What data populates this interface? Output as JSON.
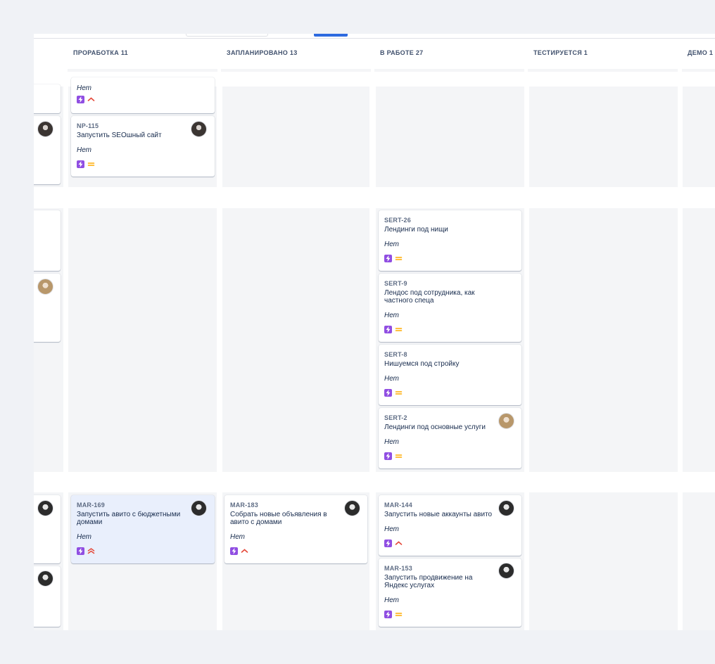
{
  "columns": [
    {
      "title": "ПРОРАБОТКА 11"
    },
    {
      "title": "ЗАПЛАНИРОВАНО 13"
    },
    {
      "title": "В РАБОТЕ 27"
    },
    {
      "title": "ТЕСТИРУЕТСЯ 1"
    },
    {
      "title": "ДЕМО 1"
    }
  ],
  "colors": {
    "epic": "#904ee2",
    "priority_high": "#e5493a",
    "priority_medium": "#ffab00",
    "selected_card": "#e9effc",
    "accent": "#2d6ae0"
  },
  "cards": {
    "c0": {
      "meta": "Нет",
      "priority": "high"
    },
    "c1": {
      "key": "NP-115",
      "title": "Запустить SEOшный сайт",
      "meta": "Нет",
      "priority": "medium"
    },
    "c2": {
      "key": "SERT-26",
      "title": "Лендинги под нищи",
      "meta": "Нет",
      "priority": "medium"
    },
    "c3": {
      "key": "SERT-9",
      "title": "Лендос под сотрудника, как частного спеца",
      "meta": "Нет",
      "priority": "medium"
    },
    "c4": {
      "key": "SERT-8",
      "title": "Нишуемся под стройку",
      "meta": "Нет",
      "priority": "medium"
    },
    "c5": {
      "key": "SERT-2",
      "title": "Лендинги под основные услуги",
      "meta": "Нет",
      "priority": "medium"
    },
    "c6": {
      "key": "MAR-169",
      "title": "Запустить авито с бюджетными домами",
      "meta": "Нет",
      "priority": "highest"
    },
    "c7": {
      "key": "MAR-183",
      "title": "Собрать новые объявления в авито с домами",
      "meta": "Нет",
      "priority": "high"
    },
    "c8": {
      "key": "MAR-144",
      "title": "Запустить новые аккаунты авито",
      "meta": "Нет",
      "priority": "high"
    },
    "c9": {
      "key": "MAR-153",
      "title": "Запустить продвижение на Яндекс услугах",
      "meta": "Нет",
      "priority": "medium"
    }
  },
  "icons": {
    "epic": "lightning-icon",
    "priority_high": "priority-high-icon",
    "priority_highest": "priority-highest-icon",
    "priority_medium": "priority-medium-icon"
  }
}
